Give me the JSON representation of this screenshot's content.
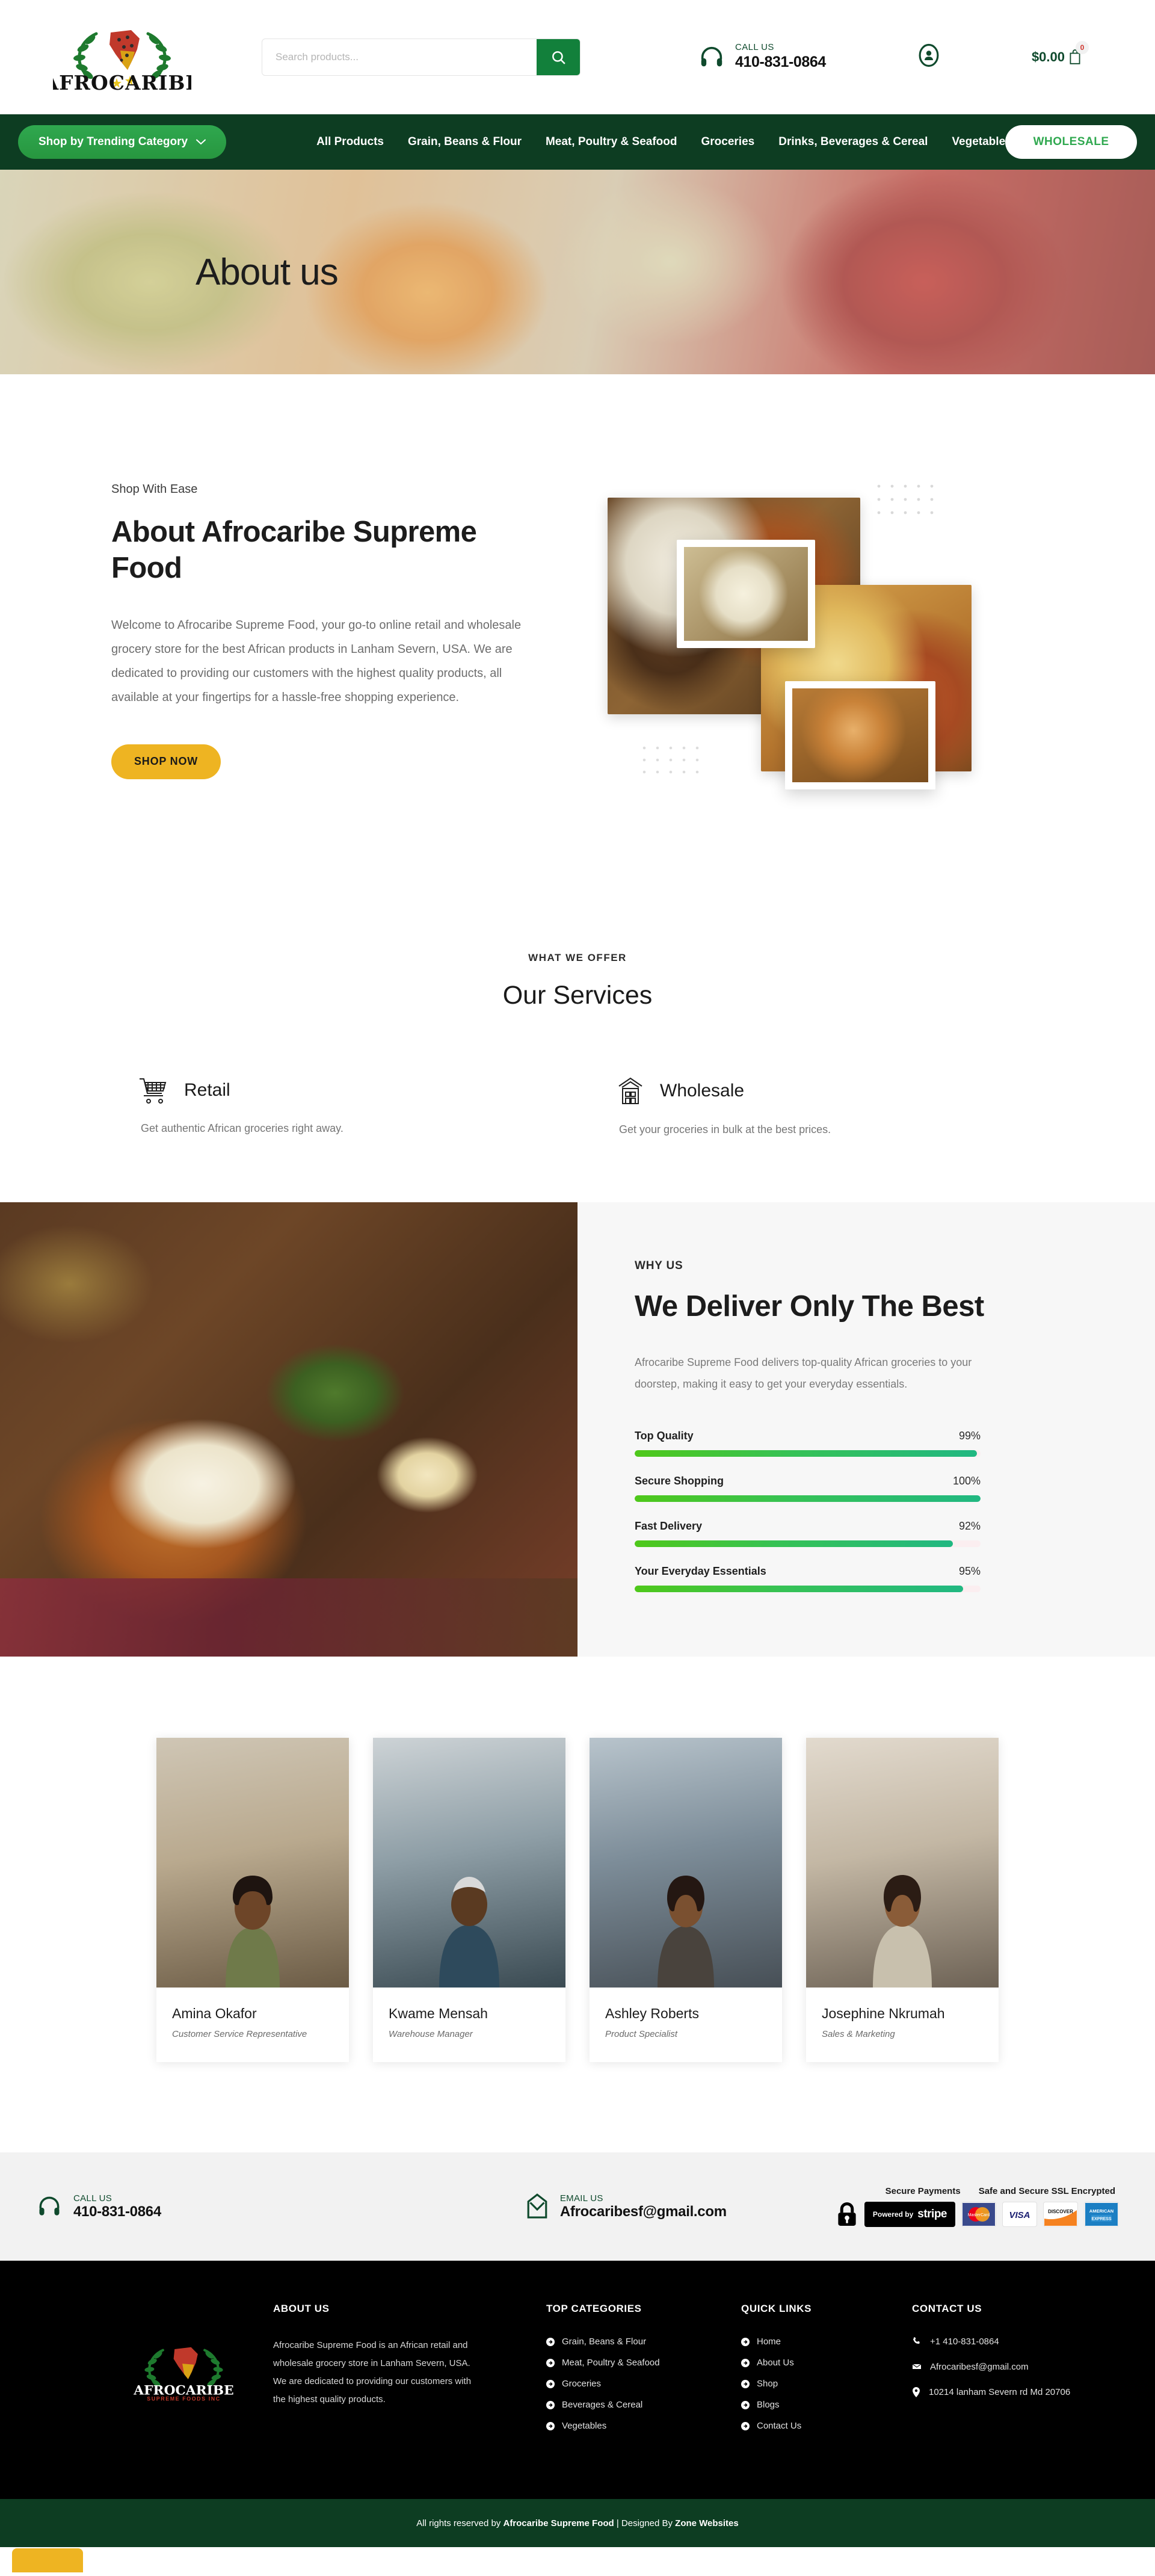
{
  "header": {
    "logo": {
      "main": "AFROCARIBE",
      "sub": "SUPREME FOODS INC"
    },
    "search": {
      "placeholder": "Search products...",
      "value": "",
      "icon": "search-icon"
    },
    "call": {
      "label": "CALL US",
      "number": "410-831-0864",
      "icon": "headset-icon"
    },
    "account_icon": "user-circle-icon",
    "cart": {
      "price": "$0.00",
      "count": "0",
      "icon": "cart-icon"
    }
  },
  "nav": {
    "trending_label": "Shop by Trending Category",
    "chevron": "chevron-down-icon",
    "links": [
      "All Products",
      "Grain, Beans & Flour",
      "Meat, Poultry & Seafood",
      "Groceries",
      "Drinks, Beverages & Cereal",
      "Vegetable"
    ],
    "wholesale_label": "WHOLESALE"
  },
  "hero": {
    "title": "About us"
  },
  "about": {
    "eyebrow": "Shop With Ease",
    "heading": "About Afrocaribe Supreme Food",
    "body": "Welcome to Afrocaribe Supreme Food, your go-to online retail and wholesale grocery store for the best African products in Lanham Severn, USA. We are dedicated to providing our customers with the highest quality products, all available at your fingertips for a hassle-free shopping experience.",
    "cta": "SHOP NOW"
  },
  "services": {
    "kicker": "WHAT WE OFFER",
    "heading": "Our Services",
    "items": [
      {
        "title": "Retail",
        "desc": "Get authentic African groceries right away.",
        "icon": "shopping-cart-icon"
      },
      {
        "title": "Wholesale",
        "desc": "Get your groceries in bulk at the best prices.",
        "icon": "warehouse-icon"
      }
    ]
  },
  "whyus": {
    "kicker": "WHY US",
    "heading": "We Deliver Only The Best",
    "body": "Afrocaribe Supreme Food delivers top-quality African groceries to your doorstep, making it easy to get your everyday essentials.",
    "bars": [
      {
        "label": "Top Quality",
        "value": "99%",
        "pct": 99
      },
      {
        "label": "Secure Shopping",
        "value": "100%",
        "pct": 100
      },
      {
        "label": "Fast Delivery",
        "value": "92%",
        "pct": 92
      },
      {
        "label": "Your Everyday Essentials",
        "value": "95%",
        "pct": 95
      }
    ]
  },
  "team": [
    {
      "name": "Amina Okafor",
      "role": "Customer Service Representative"
    },
    {
      "name": "Kwame Mensah",
      "role": "Warehouse Manager"
    },
    {
      "name": "Ashley Roberts",
      "role": "Product Specialist"
    },
    {
      "name": "Josephine Nkrumah",
      "role": "Sales & Marketing"
    }
  ],
  "contact_strip": {
    "call": {
      "label": "CALL US",
      "value": "410-831-0864",
      "icon": "headset-icon"
    },
    "email": {
      "label": "EMAIL US",
      "value": "Afrocaribesf@gmail.com",
      "icon": "envelope-icon"
    },
    "payments": {
      "secure_title": "Secure Payments",
      "ssl_title": "Safe and Secure SSL Encrypted",
      "lock_icon": "lock-icon",
      "stripe_prefix": "Powered by",
      "stripe_name": "stripe",
      "cards": [
        "MasterCard",
        "VISA",
        "DISCOVER",
        "AMERICAN EXPRESS"
      ]
    }
  },
  "footer": {
    "about": {
      "title": "ABOUT US",
      "text": "Afrocaribe Supreme Food is an African retail and wholesale grocery store in Lanham Severn, USA. We are dedicated to providing our customers with the highest quality products."
    },
    "categories": {
      "title": "TOP CATEGORIES",
      "items": [
        "Grain, Beans & Flour",
        "Meat, Poultry & Seafood",
        "Groceries",
        "Beverages & Cereal",
        "Vegetables"
      ]
    },
    "quick": {
      "title": "QUICK LINKS",
      "items": [
        "Home",
        "About Us",
        "Shop",
        "Blogs",
        "Contact Us"
      ]
    },
    "contact": {
      "title": "CONTACT US",
      "phone": "+1 410-831-0864",
      "email": "Afrocaribesf@gmail.com",
      "address": "10214 lanham Severn rd Md 20706",
      "phone_icon": "phone-icon",
      "email_icon": "envelope-icon",
      "address_icon": "map-pin-icon"
    }
  },
  "copyright": {
    "prefix": "All rights reserved by",
    "brand": "Afrocaribe Supreme Food",
    "middle": "| Designed By",
    "designer": "Zone Websites"
  },
  "colors": {
    "brand_green": "#0d3d22",
    "accent_green": "#2fa84f",
    "yellow": "#eeb422",
    "maroon": "#9b2242"
  }
}
